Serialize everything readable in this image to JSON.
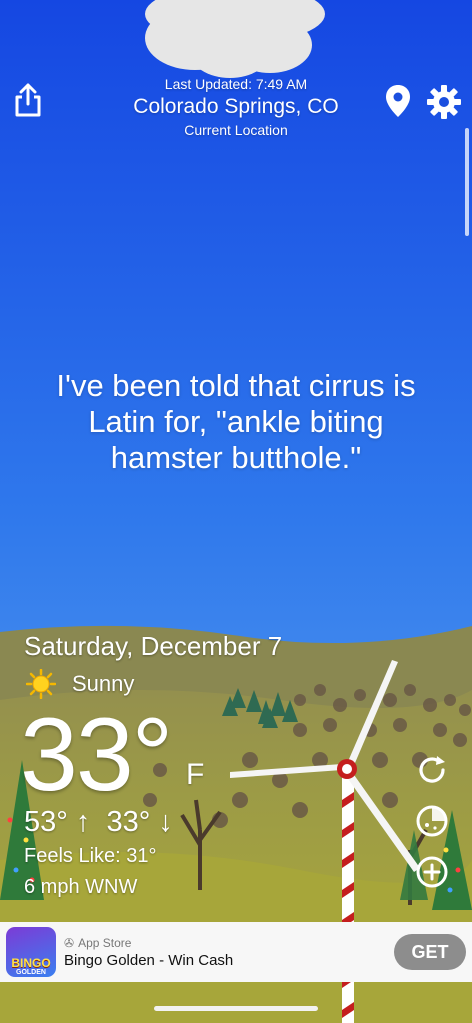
{
  "header": {
    "last_updated": "Last Updated: 7:49 AM",
    "city": "Colorado Springs, CO",
    "sub_location": "Current Location"
  },
  "icons": {
    "share": "share-icon",
    "location": "location-pin-icon",
    "settings": "gear-icon",
    "refresh": "refresh-icon",
    "radar": "radar-icon",
    "add_location": "add-location-icon"
  },
  "quote": "I've been told that cirrus is Latin for, \"ankle biting hamster butthole.\"",
  "weather": {
    "date": "Saturday, December 7",
    "condition": "Sunny",
    "temperature": "33°",
    "unit": "F",
    "high_low": "53° ↑  33° ↓",
    "feels_like": "Feels Like: 31°",
    "wind": "6 mph WNW"
  },
  "ad": {
    "store_label": "App Store",
    "title": "Bingo Golden - Win Cash",
    "button_label": "GET",
    "logo_text": "BINGO",
    "logo_sub": "GOLDEN"
  },
  "colors": {
    "sky_top": "#1a52e6",
    "sky_bottom": "#5aa2ee",
    "hills": "#8b8a4a",
    "ground": "#a8a83c",
    "turbine_stripe": "#c41e1e"
  }
}
